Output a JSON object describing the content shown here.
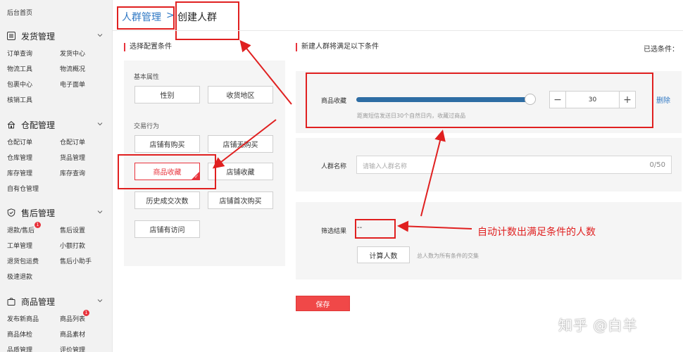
{
  "sidebar": {
    "home": "后台首页",
    "sections": [
      {
        "title": "发货管理",
        "icon": "list-icon",
        "items": [
          "订单查询",
          "发货中心",
          "物流工具",
          "物流概况",
          "包裹中心",
          "电子面单",
          "核销工具"
        ]
      },
      {
        "title": "仓配管理",
        "icon": "house-icon",
        "items": [
          "仓配订单",
          "仓配订单",
          "仓库管理",
          "货品管理",
          "库存管理",
          "库存查询",
          "自有仓管理"
        ]
      },
      {
        "title": "售后管理",
        "icon": "shield-icon",
        "items": [
          "退款/售后",
          "售后设置",
          "工单管理",
          "小额打款",
          "退货包运费",
          "售后小助手",
          "极速退款"
        ],
        "badge": "1"
      },
      {
        "title": "商品管理",
        "icon": "bag-icon",
        "items": [
          "发布新商品",
          "商品列表",
          "商品体检",
          "商品素材",
          "品质管理",
          "评价管理"
        ],
        "badge": "1"
      }
    ]
  },
  "breadcrumb": {
    "parent": "人群管理",
    "separator": ">",
    "current": "创建人群"
  },
  "left_title": "选择配置条件",
  "right_title": "新建人群将满足以下条件",
  "selected_label": "已选条件：",
  "config": {
    "basic_label": "基本属性",
    "basic": [
      "性别",
      "收货地区"
    ],
    "trade_label": "交易行为",
    "trade": [
      "店铺有购买",
      "店铺无购买",
      "商品收藏",
      "店铺收藏",
      "历史成交次数",
      "店铺首次购买",
      "店铺有访问"
    ],
    "selected": "商品收藏",
    "check": "✓"
  },
  "condition": {
    "label": "商品收藏",
    "value": "30",
    "slider_fraction": 0.98,
    "minus": "−",
    "plus": "+",
    "delete": "删除",
    "hint": "距离短信发送日30个自然日内，收藏过商品"
  },
  "name_field": {
    "label": "人群名称",
    "placeholder": "请输入人群名称",
    "count": "0/50"
  },
  "result": {
    "label": "筛选结果",
    "value": "--",
    "calc_button": "计算人数",
    "hint": "总人数为所有条件的交集"
  },
  "annotation": "自动计数出满足条件的人数",
  "save": "保存",
  "watermark": "知乎 @白羊",
  "colors": {
    "accent_red": "#e8333c",
    "link_blue": "#2f78c4",
    "slider_blue": "#2e6da4",
    "annotation_red": "#e02020"
  }
}
